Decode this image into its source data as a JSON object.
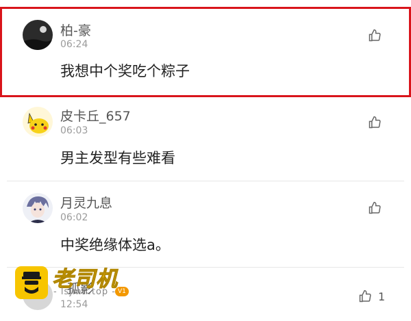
{
  "comments": [
    {
      "name": "柏-豪",
      "time": "06:24",
      "text": "我想中个奖吃个粽子",
      "like_count": ""
    },
    {
      "name": "皮卡丘_657",
      "time": "06:03",
      "text": "男主发型有些难看",
      "like_count": ""
    },
    {
      "name": "月灵九息",
      "time": "06:02",
      "text": "中奖绝缘体选a。",
      "like_count": ""
    },
    {
      "name": "孤影",
      "time": "12:54",
      "text": "",
      "like_count": "1"
    }
  ],
  "watermark": {
    "brand": "老司机",
    "domain": "- lsjmh.top -",
    "vip": "V1"
  },
  "colors": {
    "highlight_border": "#d9141b",
    "watermark_yellow": "#f7c500"
  },
  "icons": {
    "like": "thumbs-up-icon"
  }
}
